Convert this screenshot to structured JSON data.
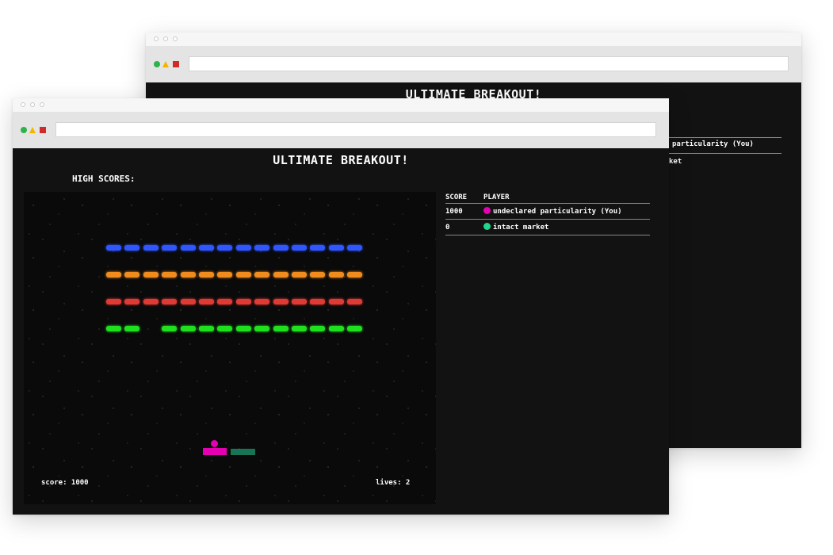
{
  "game_title": "ULTIMATE BREAKOUT!",
  "high_scores_label": "HIGH SCORES:",
  "table": {
    "headers": {
      "score": "SCORE",
      "player": "PLAYER"
    },
    "rows": [
      {
        "score": "1000",
        "player": "undeclared particularity (You)",
        "color": "#e600b4"
      },
      {
        "score": "0",
        "player": "intact market",
        "color": "#1ed68c"
      }
    ]
  },
  "back_window": {
    "title": "ULTIMATE BREAKOUT!",
    "row1_fragment": "particularity (You)",
    "row2_fragment": "ket"
  },
  "hud": {
    "score_text": "score: 1000",
    "lives_text": "lives: 2",
    "score": 1000,
    "lives": 2
  },
  "window_controls": {
    "colors": {
      "green": "#2eb34a",
      "yellow": "#f2b600",
      "red": "#d02b2b"
    }
  },
  "bricks": {
    "rows": [
      {
        "color": "blue",
        "cells": [
          1,
          1,
          1,
          1,
          1,
          1,
          1,
          1,
          1,
          1,
          1,
          1,
          1,
          1
        ]
      },
      {
        "color": "orange",
        "cells": [
          1,
          1,
          1,
          1,
          1,
          1,
          1,
          1,
          1,
          1,
          1,
          1,
          1,
          1
        ]
      },
      {
        "color": "red",
        "cells": [
          1,
          1,
          1,
          1,
          1,
          1,
          1,
          1,
          1,
          1,
          1,
          1,
          1,
          1
        ]
      },
      {
        "color": "green",
        "cells": [
          1,
          1,
          0,
          1,
          1,
          1,
          1,
          1,
          1,
          1,
          1,
          1,
          1,
          1
        ]
      }
    ]
  },
  "players": [
    {
      "name": "undeclared particularity (You)",
      "color": "#e600b4"
    },
    {
      "name": "intact market",
      "color": "#1ed68c"
    }
  ]
}
